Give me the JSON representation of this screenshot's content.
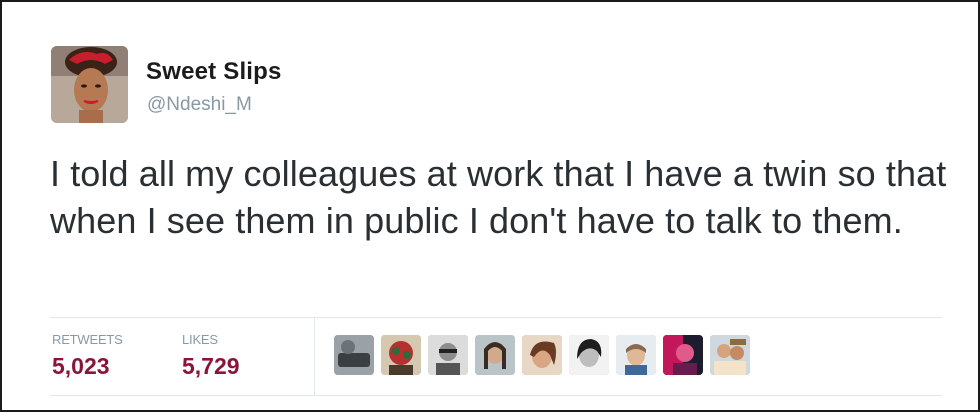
{
  "tweet": {
    "user_name": "Sweet Slips",
    "user_handle": "@Ndeshi_M",
    "text": "I told all my colleagues at work that I have a twin so that when I see them in public I don't have to talk to them.",
    "stats": {
      "retweets_label": "RETWEETS",
      "retweets_value": "5,023",
      "likes_label": "LIKES",
      "likes_value": "5,729"
    },
    "likers_count_shown": 9
  },
  "colors": {
    "stat_value": "#8a1538",
    "handle": "#8899a6",
    "text": "#292f33",
    "divider": "#e1e8ed"
  }
}
